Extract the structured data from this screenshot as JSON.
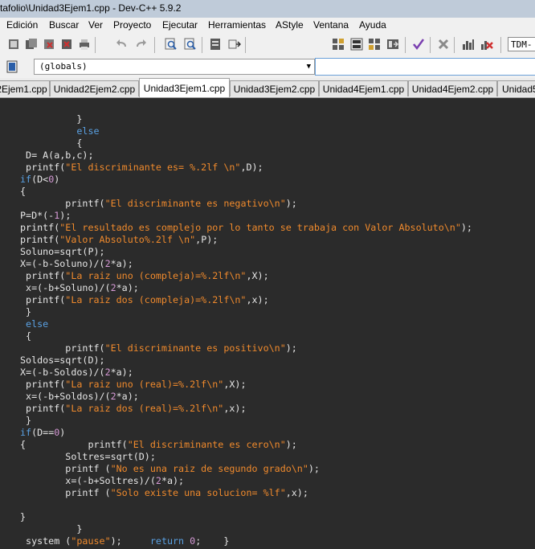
{
  "window": {
    "title": "tafolio\\Unidad3Ejem1.cpp - Dev-C++ 5.9.2"
  },
  "menu": [
    "Edición",
    "Buscar",
    "Ver",
    "Proyecto",
    "Ejecutar",
    "Herramientas",
    "AStyle",
    "Ventana",
    "Ayuda"
  ],
  "toolbar": {
    "compiler_label": "TDM-"
  },
  "scope": {
    "value": "(globals)"
  },
  "tabs": [
    {
      "label": "2Ejem1.cpp",
      "active": false
    },
    {
      "label": "Unidad2Ejem2.cpp",
      "active": false
    },
    {
      "label": "Unidad3Ejem1.cpp",
      "active": true
    },
    {
      "label": "Unidad3Ejem2.cpp",
      "active": false
    },
    {
      "label": "Unidad4Ejem1.cpp",
      "active": false
    },
    {
      "label": "Unidad4Ejem2.cpp",
      "active": false
    },
    {
      "label": "Unidad5",
      "active": false
    }
  ],
  "code": [
    [
      [
        "p",
        "          }"
      ]
    ],
    [
      [
        "k",
        "          else"
      ]
    ],
    [
      [
        "p",
        "          {"
      ]
    ],
    [
      [
        "p",
        " D= A(a,b,c);"
      ]
    ],
    [
      [
        "p",
        " printf("
      ],
      [
        "s",
        "\"El discriminante es= %.2lf \\n\""
      ],
      [
        "p",
        ",D);"
      ]
    ],
    [
      [
        "k",
        "if"
      ],
      [
        "p",
        "(D<"
      ],
      [
        "n",
        "0"
      ],
      [
        "p",
        ")"
      ]
    ],
    [
      [
        "p",
        "{"
      ]
    ],
    [
      [
        "p",
        "        printf("
      ],
      [
        "s",
        "\"El discriminante es negativo\\n\""
      ],
      [
        "p",
        ");"
      ]
    ],
    [
      [
        "p",
        "P=D*(-"
      ],
      [
        "n",
        "1"
      ],
      [
        "p",
        ");"
      ]
    ],
    [
      [
        "p",
        "printf("
      ],
      [
        "s",
        "\"El resultado es complejo por lo tanto se trabaja con Valor Absoluto\\n\""
      ],
      [
        "p",
        ");"
      ]
    ],
    [
      [
        "p",
        "printf("
      ],
      [
        "s",
        "\"Valor Absoluto%.2lf \\n\""
      ],
      [
        "p",
        ",P);"
      ]
    ],
    [
      [
        "p",
        "Soluno=sqrt(P);"
      ]
    ],
    [
      [
        "p",
        "X=(-b-Soluno)/("
      ],
      [
        "n",
        "2"
      ],
      [
        "p",
        "*a);"
      ]
    ],
    [
      [
        "p",
        " printf("
      ],
      [
        "s",
        "\"La raiz uno (compleja)=%.2lf\\n\""
      ],
      [
        "p",
        ",X);"
      ]
    ],
    [
      [
        "p",
        " x=(-b+Soluno)/("
      ],
      [
        "n",
        "2"
      ],
      [
        "p",
        "*a);"
      ]
    ],
    [
      [
        "p",
        " printf("
      ],
      [
        "s",
        "\"La raiz dos (compleja)=%.2lf\\n\""
      ],
      [
        "p",
        ",x);"
      ]
    ],
    [
      [
        "p",
        " }"
      ]
    ],
    [
      [
        "k",
        " else"
      ]
    ],
    [
      [
        "p",
        " {"
      ]
    ],
    [
      [
        "p",
        "        printf("
      ],
      [
        "s",
        "\"El discriminante es positivo\\n\""
      ],
      [
        "p",
        ");"
      ]
    ],
    [
      [
        "p",
        "Soldos=sqrt(D);"
      ]
    ],
    [
      [
        "p",
        "X=(-b-Soldos)/("
      ],
      [
        "n",
        "2"
      ],
      [
        "p",
        "*a);"
      ]
    ],
    [
      [
        "p",
        " printf("
      ],
      [
        "s",
        "\"La raiz uno (real)=%.2lf\\n\""
      ],
      [
        "p",
        ",X);"
      ]
    ],
    [
      [
        "p",
        " x=(-b+Soldos)/("
      ],
      [
        "n",
        "2"
      ],
      [
        "p",
        "*a);"
      ]
    ],
    [
      [
        "p",
        " printf("
      ],
      [
        "s",
        "\"La raiz dos (real)=%.2lf\\n\""
      ],
      [
        "p",
        ",x);"
      ]
    ],
    [
      [
        "p",
        " }"
      ]
    ],
    [
      [
        "k",
        "if"
      ],
      [
        "p",
        "(D=="
      ],
      [
        "n",
        "0"
      ],
      [
        "p",
        ")"
      ]
    ],
    [
      [
        "p",
        "{           printf("
      ],
      [
        "s",
        "\"El discriminante es cero\\n\""
      ],
      [
        "p",
        ");"
      ]
    ],
    [
      [
        "p",
        "        Soltres=sqrt(D);"
      ]
    ],
    [
      [
        "p",
        "        printf ("
      ],
      [
        "s",
        "\"No es una raiz de segundo grado\\n\""
      ],
      [
        "p",
        ");"
      ]
    ],
    [
      [
        "p",
        "        x=(-b+Soltres)/("
      ],
      [
        "n",
        "2"
      ],
      [
        "p",
        "*a);"
      ]
    ],
    [
      [
        "p",
        "        printf ("
      ],
      [
        "s",
        "\"Solo existe una solucion= %lf\""
      ],
      [
        "p",
        ",x);"
      ]
    ],
    [
      [
        "p",
        ""
      ]
    ],
    [
      [
        "p",
        "}"
      ]
    ],
    [
      [
        "p",
        "          }"
      ]
    ],
    [
      [
        "p",
        " system ("
      ],
      [
        "s",
        "\"pause\""
      ],
      [
        "p",
        ");     "
      ],
      [
        "k",
        "return"
      ],
      [
        "p",
        " "
      ],
      [
        "n",
        "0"
      ],
      [
        "p",
        ";    }"
      ]
    ]
  ],
  "colors": {
    "editor_bg": "#2b2b2b",
    "keyword": "#5aa1e3",
    "string": "#f08a2c",
    "number": "#d69ad6",
    "plain": "#e6e6e6"
  }
}
